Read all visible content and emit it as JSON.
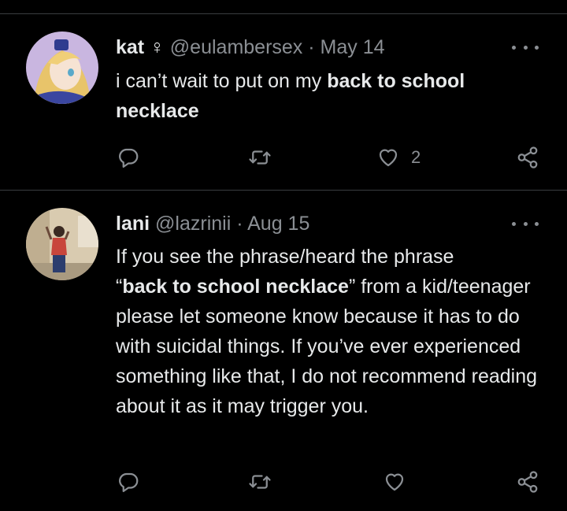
{
  "tweets": [
    {
      "display_name": "kat",
      "badge_glyph": "♀",
      "handle": "@eulambersex",
      "separator": "·",
      "date": "May 14",
      "text_plain": "i can’t wait to put on my ",
      "text_bold": "back to school necklace",
      "like_count": "2",
      "icons": [
        "more-icon",
        "reply-icon",
        "retweet-icon",
        "like-icon",
        "share-icon"
      ]
    },
    {
      "display_name": "lani",
      "handle": "@lazrinii",
      "separator": "·",
      "date": "Aug 15",
      "text_part1": "If you see the phrase/heard the phrase",
      "quote_open": "“",
      "text_bold": "back to school necklace",
      "text_part2": "” from a kid/teenager please let someone know because it has to do with suicidal things. If you’ve ever experienced something like that, I do not recommend reading about it as it may trigger you.",
      "icons": [
        "more-icon",
        "reply-icon",
        "retweet-icon",
        "like-icon",
        "share-icon"
      ]
    }
  ],
  "colors": {
    "background": "#000000",
    "text": "#e7e9ea",
    "muted": "#8b8f94",
    "divider": "#3a3d40"
  }
}
